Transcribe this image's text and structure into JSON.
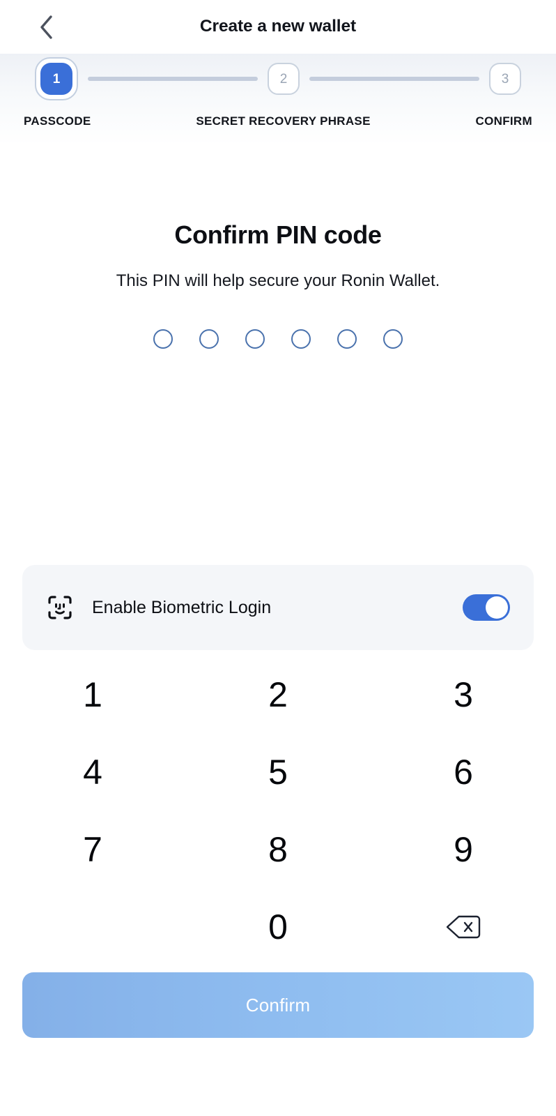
{
  "header": {
    "back_icon": "chevron-left-icon",
    "title": "Create a new wallet"
  },
  "stepper": {
    "steps": [
      {
        "number": "1",
        "label": "PASSCODE",
        "state": "active"
      },
      {
        "number": "2",
        "label": "SECRET RECOVERY PHRASE",
        "state": "idle"
      },
      {
        "number": "3",
        "label": "CONFIRM",
        "state": "idle"
      }
    ]
  },
  "main": {
    "title": "Confirm PIN code",
    "subtitle": "This PIN will help secure your Ronin Wallet.",
    "pin": {
      "length": 6,
      "entered": 0
    }
  },
  "biometric": {
    "icon": "face-id-icon",
    "label": "Enable Biometric Login",
    "toggle_state": "on"
  },
  "keypad": {
    "keys": [
      {
        "label": "1",
        "name": "keypad-key-1"
      },
      {
        "label": "2",
        "name": "keypad-key-2"
      },
      {
        "label": "3",
        "name": "keypad-key-3"
      },
      {
        "label": "4",
        "name": "keypad-key-4"
      },
      {
        "label": "5",
        "name": "keypad-key-5"
      },
      {
        "label": "6",
        "name": "keypad-key-6"
      },
      {
        "label": "7",
        "name": "keypad-key-7"
      },
      {
        "label": "8",
        "name": "keypad-key-8"
      },
      {
        "label": "9",
        "name": "keypad-key-9"
      },
      {
        "label": "",
        "name": "keypad-key-blank"
      },
      {
        "label": "0",
        "name": "keypad-key-0"
      },
      {
        "label": "",
        "name": "keypad-key-backspace",
        "icon": "backspace-icon"
      }
    ]
  },
  "footer": {
    "confirm_label": "Confirm",
    "confirm_enabled": false
  },
  "colors": {
    "accent_blue": "#3a6fd8",
    "step_line_gray": "#c4cddc",
    "idle_step_gray": "#9aa5b5",
    "pin_dot_border": "#4a72ad",
    "card_bg": "#f4f6f9",
    "confirm_disabled_from": "#84b0e8",
    "confirm_disabled_to": "#9ac7f4",
    "text_primary": "#0d0f14"
  }
}
